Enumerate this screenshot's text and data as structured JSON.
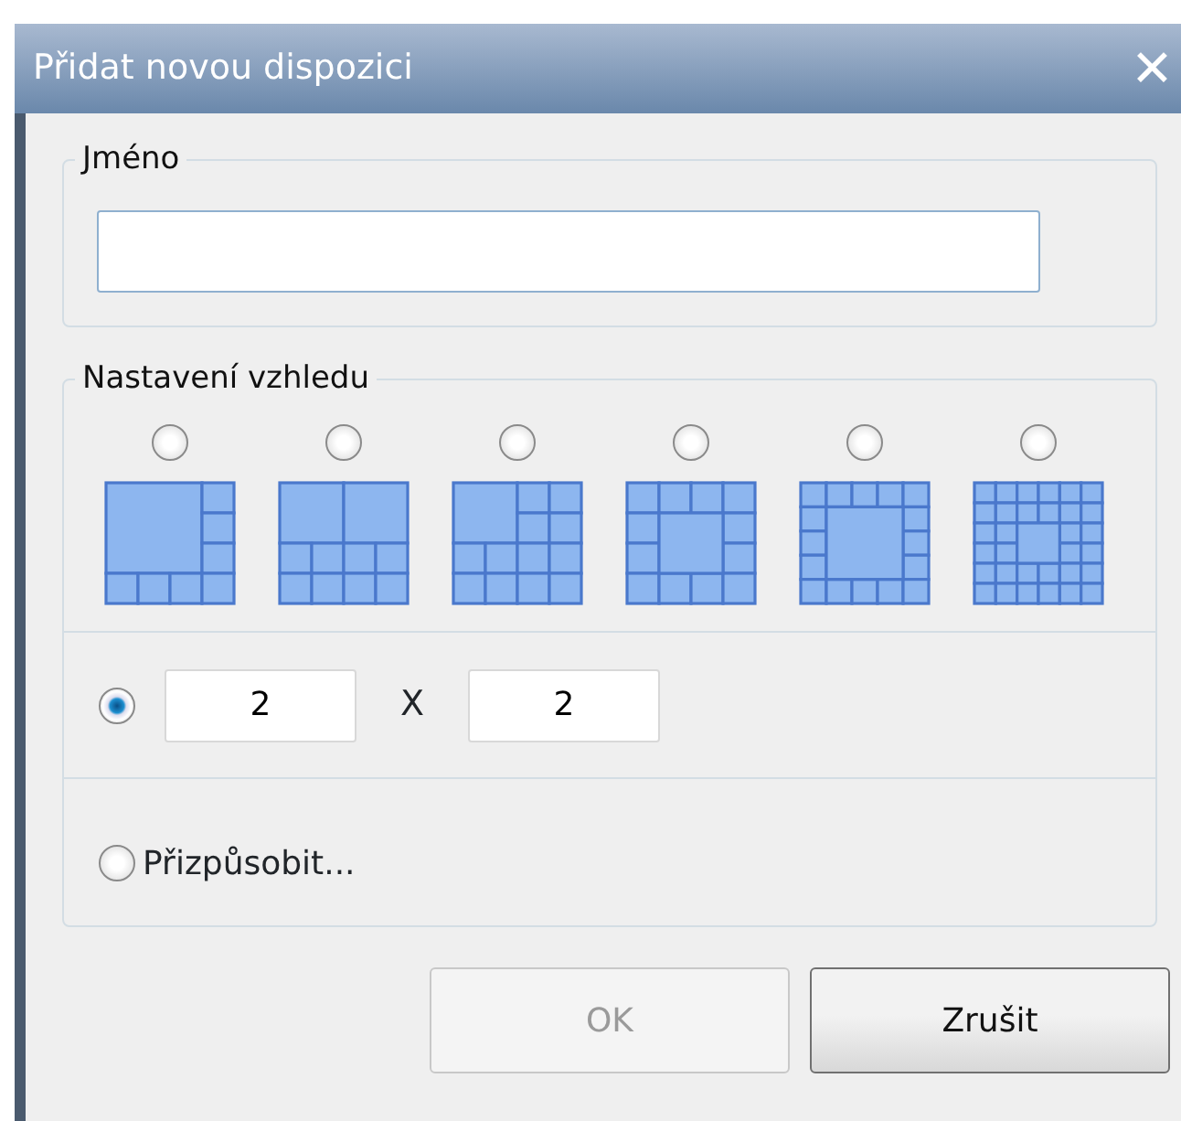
{
  "window": {
    "title": "Přidat novou dispozici",
    "close": "✕"
  },
  "name_group": {
    "legend": "Jméno"
  },
  "layout_group": {
    "legend": "Nastavení vzhledu",
    "options": [
      {
        "kind": "side",
        "selected": false
      },
      {
        "kind": "halves",
        "selected": false
      },
      {
        "kind": "corner",
        "selected": false
      },
      {
        "kind": "ring4",
        "selected": false
      },
      {
        "kind": "ring5",
        "selected": false
      },
      {
        "kind": "ring6",
        "selected": false
      }
    ],
    "grid_option": {
      "selected": true,
      "rows": "2",
      "separator": "X",
      "cols": "2"
    },
    "custom_option": {
      "label": "Přizpůsobit...",
      "selected": false
    }
  },
  "buttons": [
    {
      "label": "OK",
      "disabled": true
    },
    {
      "label": "Zrušit",
      "disabled": false
    }
  ]
}
